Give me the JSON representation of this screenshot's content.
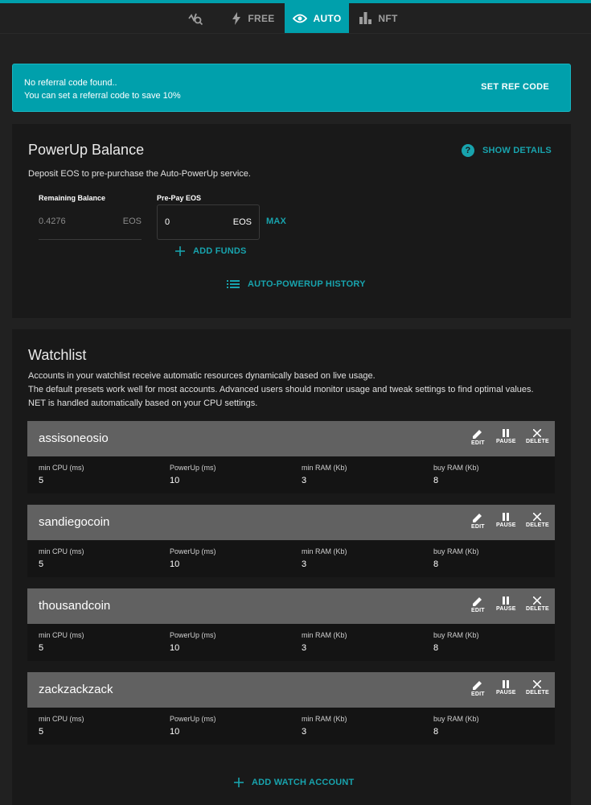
{
  "nav": {
    "tabs": [
      {
        "label": "",
        "icon": "chart-search-icon",
        "active": false
      },
      {
        "label": "FREE",
        "icon": "lightning-icon",
        "active": false
      },
      {
        "label": "AUTO",
        "icon": "eye-icon",
        "active": true
      },
      {
        "label": "NFT",
        "icon": "bar-chart-icon",
        "active": false
      }
    ]
  },
  "banner": {
    "line1": "No referral code found..",
    "line2": "You can set a referral code to save 10%",
    "button": "SET REF CODE"
  },
  "balance": {
    "title": "PowerUp Balance",
    "show_details": "SHOW DETAILS",
    "description": "Deposit EOS to pre-purchase the Auto-PowerUp service.",
    "remaining_label": "Remaining Balance",
    "remaining_value": "0.4276",
    "remaining_unit": "EOS",
    "prepay_label": "Pre-Pay EOS",
    "prepay_value": "0",
    "prepay_unit": "EOS",
    "max": "MAX",
    "add_funds": "ADD FUNDS",
    "history": "AUTO-POWERUP HISTORY"
  },
  "watchlist": {
    "title": "Watchlist",
    "desc1": "Accounts in your watchlist receive automatic resources dynamically based on live usage.",
    "desc2": "The default presets work well for most accounts. Advanced users should monitor usage and tweak settings to find optimal values.",
    "desc3": "NET is handled automatically based on your CPU settings.",
    "actions": {
      "edit": "EDIT",
      "pause": "PAUSE",
      "delete": "DELETE"
    },
    "stat_labels": {
      "min_cpu": "min CPU (ms)",
      "powerup": "PowerUp (ms)",
      "min_ram": "min RAM (Kb)",
      "buy_ram": "buy RAM (Kb)"
    },
    "accounts": [
      {
        "name": "assisoneosio",
        "min_cpu": "5",
        "powerup": "10",
        "min_ram": "3",
        "buy_ram": "8"
      },
      {
        "name": "sandiegocoin",
        "min_cpu": "5",
        "powerup": "10",
        "min_ram": "3",
        "buy_ram": "8"
      },
      {
        "name": "thousandcoin",
        "min_cpu": "5",
        "powerup": "10",
        "min_ram": "3",
        "buy_ram": "8"
      },
      {
        "name": "zackzackzack",
        "min_cpu": "5",
        "powerup": "10",
        "min_ram": "3",
        "buy_ram": "8"
      }
    ],
    "add_account": "ADD WATCH ACCOUNT"
  },
  "colors": {
    "accent": "#00a0ac",
    "accent_text": "#18a3ad",
    "background": "#212121",
    "card": "#191919",
    "account_header": "#616161"
  }
}
